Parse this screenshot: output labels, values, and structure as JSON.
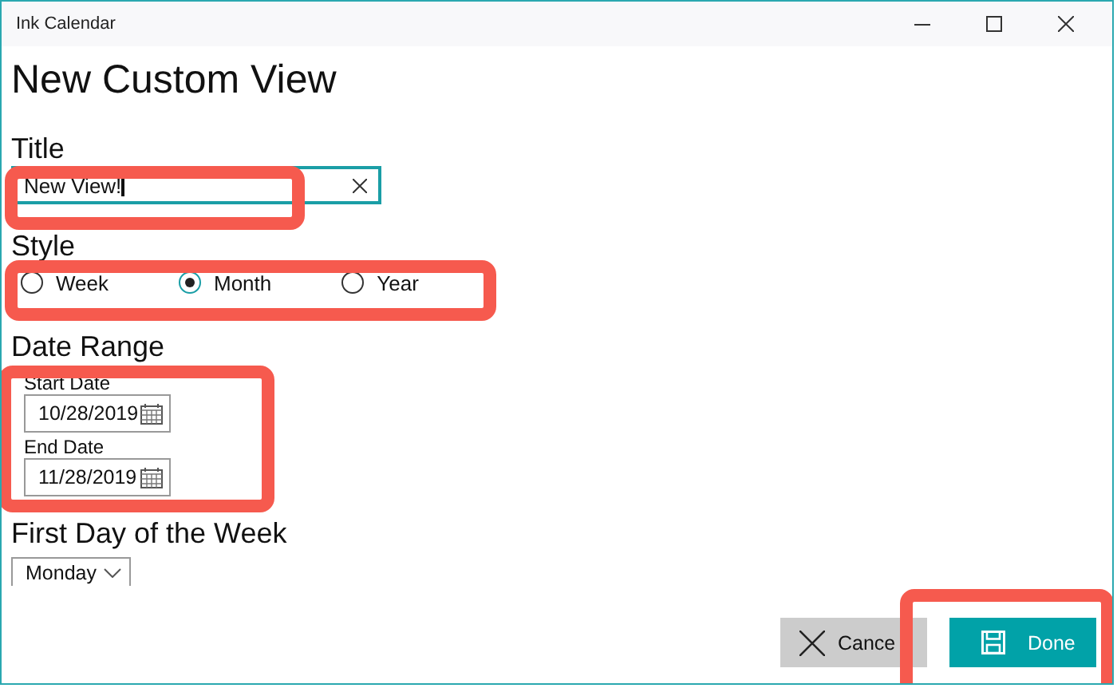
{
  "window": {
    "title": "Ink Calendar"
  },
  "heading": "New Custom View",
  "title_field": {
    "label": "Title",
    "value": "New View!"
  },
  "style": {
    "label": "Style",
    "options": [
      {
        "label": "Week",
        "selected": false
      },
      {
        "label": "Month",
        "selected": true
      },
      {
        "label": "Year",
        "selected": false
      }
    ]
  },
  "date_range": {
    "label": "Date Range",
    "fields": [
      {
        "label": "Start Date",
        "value": "10/28/2019"
      },
      {
        "label": "End Date",
        "value": "11/28/2019"
      }
    ]
  },
  "first_day": {
    "label": "First Day of the Week",
    "value": "Monday"
  },
  "buttons": [
    {
      "label": "Cance",
      "kind": "cancel"
    },
    {
      "label": "Done",
      "kind": "done"
    }
  ]
}
